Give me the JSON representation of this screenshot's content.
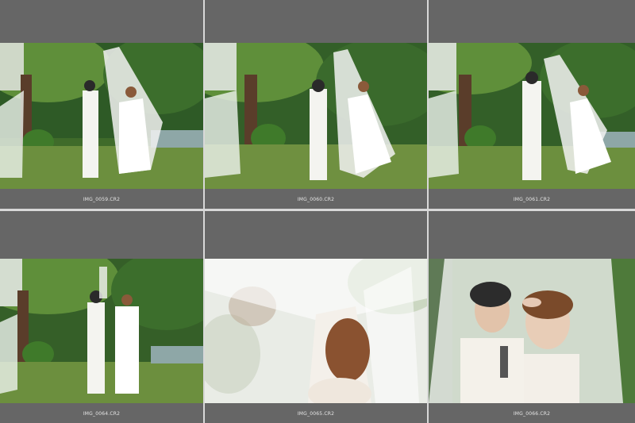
{
  "app": {
    "view": "grid"
  },
  "thumbnails": [
    {
      "filename": "IMG_0059.CR2",
      "scene": "garden-couple-walking"
    },
    {
      "filename": "IMG_0060.CR2",
      "scene": "garden-couple-spinning"
    },
    {
      "filename": "IMG_0061.CR2",
      "scene": "garden-couple-back-view"
    },
    {
      "filename": "IMG_0064.CR2",
      "scene": "garden-couple-laughing"
    },
    {
      "filename": "IMG_0065.CR2",
      "scene": "veil-closeup-blurred"
    },
    {
      "filename": "IMG_0066.CR2",
      "scene": "veil-closeup-smiling"
    }
  ],
  "colors": {
    "cell_background": "#666666",
    "grid_background": "#d8d8d8",
    "caption_text": "#e6e6e6"
  }
}
